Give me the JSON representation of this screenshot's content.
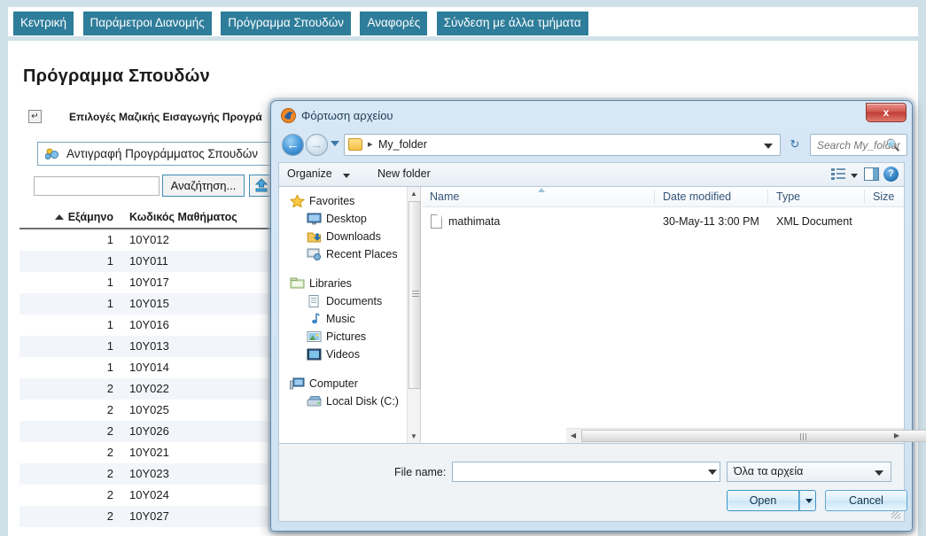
{
  "app": {
    "nav_items": [
      {
        "label": "Κεντρική",
        "name": "nav-kentriki"
      },
      {
        "label": "Παράμετροι Διανομής",
        "name": "nav-parametroi-dianomis"
      },
      {
        "label": "Πρόγραμμα Σπουδών",
        "name": "nav-programma-spoudon"
      },
      {
        "label": "Αναφορές",
        "name": "nav-anafores"
      },
      {
        "label": "Σύνδεση με άλλα τμήματα",
        "name": "nav-syndesi"
      }
    ],
    "accent_color": "#2e7d9a",
    "frame_color": "#cfe0e8"
  },
  "main": {
    "page_title": "Πρόγραμμα Σπουδών",
    "mass_import_label": "Επιλογές Μαζικής Εισαγωγής Προγρά",
    "expander_glyph": "↵",
    "copy_program_label": "Αντιγραφή Προγράμματος Σπουδών",
    "search": {
      "value": "",
      "placeholder": "",
      "button_label": "Αναζήτηση...",
      "upload_icon": "upload-icon"
    },
    "grid": {
      "columns": [
        "Εξάμηνο",
        "Κωδικός Μαθήματος"
      ],
      "sort_column": "Εξάμηνο",
      "sort_direction": "asc",
      "rows": [
        {
          "semester": "1",
          "code": "10Y012"
        },
        {
          "semester": "1",
          "code": "10Y011"
        },
        {
          "semester": "1",
          "code": "10Y017"
        },
        {
          "semester": "1",
          "code": "10Y015"
        },
        {
          "semester": "1",
          "code": "10Y016"
        },
        {
          "semester": "1",
          "code": "10Y013"
        },
        {
          "semester": "1",
          "code": "10Y014"
        },
        {
          "semester": "2",
          "code": "10Y022"
        },
        {
          "semester": "2",
          "code": "10Y025"
        },
        {
          "semester": "2",
          "code": "10Y026"
        },
        {
          "semester": "2",
          "code": "10Y021"
        },
        {
          "semester": "2",
          "code": "10Y023"
        },
        {
          "semester": "2",
          "code": "10Y024"
        },
        {
          "semester": "2",
          "code": "10Y027"
        }
      ]
    }
  },
  "dialog": {
    "title": "Φόρτωση αρχείου",
    "app_icon": "firefox-icon",
    "close_label": "x",
    "address": {
      "back_glyph": "←",
      "forward_glyph": "→",
      "path_separator": "▸",
      "path_text": "My_folder",
      "refresh_glyph": "↻",
      "search_placeholder": "Search My_folder",
      "search_icon": "magnifier-icon"
    },
    "toolbar": {
      "organize_label": "Organize",
      "new_folder_label": "New folder",
      "view_icon": "view-list-icon",
      "preview_pane_icon": "preview-pane-icon",
      "help_label": "?"
    },
    "nav_pane": [
      {
        "label": "Favorites",
        "level": "group",
        "icon": "star-icon"
      },
      {
        "label": "Desktop",
        "level": "child",
        "icon": "desktop-icon"
      },
      {
        "label": "Downloads",
        "level": "child",
        "icon": "downloads-icon"
      },
      {
        "label": "Recent Places",
        "level": "child",
        "icon": "recent-places-icon"
      },
      {
        "label": "Libraries",
        "level": "group",
        "icon": "libraries-icon"
      },
      {
        "label": "Documents",
        "level": "child",
        "icon": "document-icon"
      },
      {
        "label": "Music",
        "level": "child",
        "icon": "music-icon"
      },
      {
        "label": "Pictures",
        "level": "child",
        "icon": "pictures-icon"
      },
      {
        "label": "Videos",
        "level": "child",
        "icon": "videos-icon"
      },
      {
        "label": "Computer",
        "level": "group",
        "icon": "computer-icon"
      },
      {
        "label": "Local Disk (C:)",
        "level": "child",
        "icon": "disk-icon"
      }
    ],
    "file_list": {
      "columns": [
        "Name",
        "Date modified",
        "Type",
        "Size"
      ],
      "sorted_by": "Name",
      "files": [
        {
          "name": "mathimata",
          "date_modified": "30-May-11 3:00 PM",
          "type": "XML Document",
          "size": ""
        }
      ]
    },
    "footer": {
      "filename_label": "File name:",
      "filename_value": "",
      "filter_value": "Όλα τα αρχεία",
      "open_label": "Open",
      "cancel_label": "Cancel"
    }
  }
}
